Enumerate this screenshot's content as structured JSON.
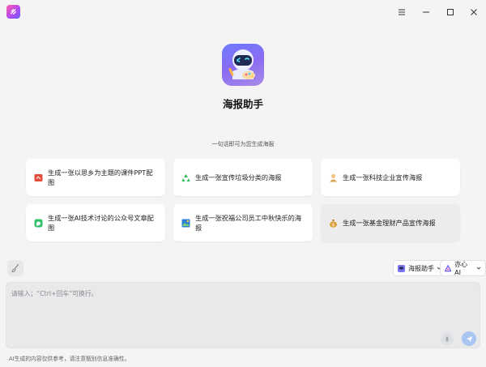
{
  "window": {
    "controls": [
      "menu-icon",
      "minimize-icon",
      "maximize-icon",
      "close-icon"
    ]
  },
  "hero": {
    "title": "海报助手",
    "subtitle": "一句话即可为您生成海报"
  },
  "suggestions": [
    {
      "label": "生成一张以思乡为主题的课件PPT配图",
      "icon": "slides-icon",
      "color": "#e24c3a"
    },
    {
      "label": "生成一张宣传垃圾分类的海报",
      "icon": "recycle-icon",
      "color": "#2fbf5a"
    },
    {
      "label": "生成一张科技企业宣传海报",
      "icon": "person-icon",
      "color": "#d8a24a"
    },
    {
      "label": "生成一张AI技术讨论的公众号文章配图",
      "icon": "chat-icon",
      "color": "#33c06b"
    },
    {
      "label": "生成一张祝福公司员工中秋快乐的海报",
      "icon": "picture-icon",
      "color": "#2f7fd9"
    },
    {
      "label": "生成一张基金理财产品宣传海报",
      "icon": "money-bag-icon",
      "color": "#d9a23a"
    }
  ],
  "toolbar": {
    "agent_label": "海报助手",
    "model_label": "亦心 AI"
  },
  "input": {
    "placeholder": "请输入；“Ctrl+回车”可换行。"
  },
  "footer": {
    "disclaimer": "AI生成的内容仅供参考，请注意甄别信息准确性。"
  },
  "colors": {
    "accent": "#a9c6f3",
    "background": "#f4f4f5",
    "card": "#ffffff"
  }
}
